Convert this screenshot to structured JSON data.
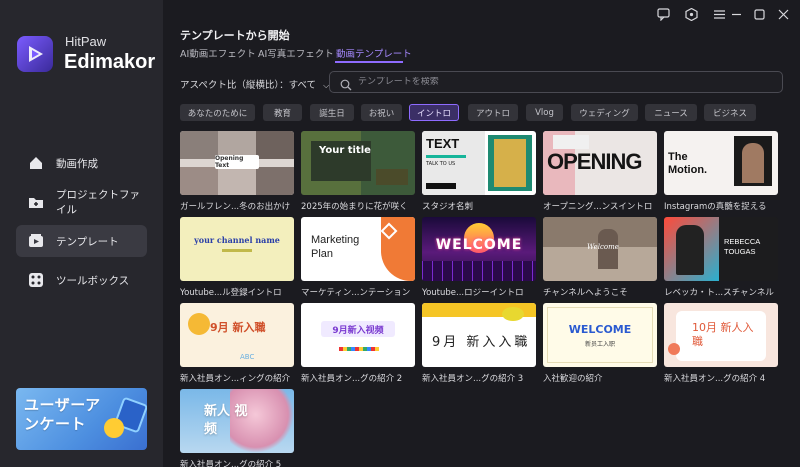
{
  "app": {
    "brand_top": "HitPaw",
    "brand_bottom": "Edimakor"
  },
  "sidebar": {
    "items": [
      {
        "label": "動画作成",
        "icon": "home-icon"
      },
      {
        "label": "プロジェクトファイル",
        "icon": "folder-icon"
      },
      {
        "label": "テンプレート",
        "icon": "template-icon",
        "active": true
      },
      {
        "label": "ツールボックス",
        "icon": "toolbox-icon"
      }
    ],
    "promo": "ユーザーア\nンケート"
  },
  "header": {
    "title": "テンプレートから開始",
    "tabs": [
      "AI動画エフェクト",
      "AI写真エフェクト",
      "動画テンプレート"
    ],
    "active_tab": 2,
    "aspect_label": "アスペクト比（縦横比）：すべて"
  },
  "search": {
    "placeholder": "テンプレートを検索"
  },
  "chips": [
    "あなたのために",
    "教育",
    "誕生日",
    "お祝い",
    "イントロ",
    "アウトロ",
    "Vlog",
    "ウェディング",
    "ニュース",
    "ビジネス"
  ],
  "active_chip": 4,
  "templates": [
    {
      "label": "ガールフレン...冬のお出かけ",
      "text": "Opening Text"
    },
    {
      "label": "2025年の始まりに花が咲く",
      "text": "Your title"
    },
    {
      "label": "スタジオ名刺",
      "text": "TEXT"
    },
    {
      "label": "オープニング...ンスイントロ",
      "text": "OPENING"
    },
    {
      "label": "Instagramの真髄を捉える",
      "text": "The Motion."
    },
    {
      "label": "Youtube...ル登録イントロ",
      "text": "your channel name"
    },
    {
      "label": "マーケティン...ンテーション",
      "text": "Marketing Plan"
    },
    {
      "label": "Youtube...ロジーイントロ",
      "text": "WELCOME"
    },
    {
      "label": "チャンネルへようこそ",
      "text": "Welcome"
    },
    {
      "label": "レベッカ・ト...スチャンネル",
      "text": "REBECCA TOUGAS"
    },
    {
      "label": "新入社員オン...ィングの紹介",
      "text": "9月 新入職"
    },
    {
      "label": "新入社員オン...グの紹介 2",
      "text": "9月新入视频"
    },
    {
      "label": "新入社員オン...グの紹介 3",
      "text": "9月 新入入職"
    },
    {
      "label": "入社歓迎の紹介",
      "text": "WELCOME"
    },
    {
      "label": "新入社員オン...グの紹介 4",
      "text": "10月 新人入職"
    },
    {
      "label": "新入社員オン...グの紹介 5",
      "text": "新人 视频"
    }
  ],
  "colors": {
    "accent": "#8e6bff",
    "bg": "#1b1b20",
    "sidebar": "#27272d"
  }
}
